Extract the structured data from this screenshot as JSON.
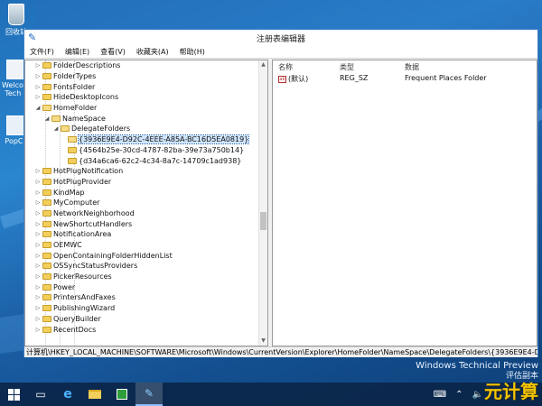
{
  "desktop": {
    "icons": [
      {
        "label": "回收站"
      },
      {
        "label": "Welcome Tech P"
      },
      {
        "label": "PopCh"
      }
    ],
    "watermark_line1": "Windows Technical Preview",
    "watermark_line2": "评估副本",
    "logo_text": "元计算"
  },
  "window": {
    "title": "注册表编辑器",
    "menus": [
      "文件(F)",
      "编辑(E)",
      "查看(V)",
      "收藏夹(A)",
      "帮助(H)"
    ]
  },
  "tree": {
    "rows": [
      {
        "label": "FolderDescriptions",
        "arrow": "▷"
      },
      {
        "label": "FolderTypes",
        "arrow": "▷"
      },
      {
        "label": "FontsFolder",
        "arrow": "▷"
      },
      {
        "label": "HideDesktopIcons",
        "arrow": "▷"
      },
      {
        "label": "HomeFolder",
        "arrow": "◢"
      },
      {
        "label": "NameSpace",
        "arrow": "◢"
      },
      {
        "label": "DelegateFolders",
        "arrow": "◢"
      },
      {
        "label": "{3936E9E4-D92C-4EEE-A85A-BC16D5EA0819}",
        "arrow": "",
        "selected": true
      },
      {
        "label": "{4564b25e-30cd-4787-82ba-39e73a750b14}",
        "arrow": ""
      },
      {
        "label": "{d34a6ca6-62c2-4c34-8a7c-14709c1ad938}",
        "arrow": ""
      },
      {
        "label": "HotPlugNotification",
        "arrow": "▷"
      },
      {
        "label": "HotPlugProvider",
        "arrow": "▷"
      },
      {
        "label": "KindMap",
        "arrow": "▷"
      },
      {
        "label": "MyComputer",
        "arrow": "▷"
      },
      {
        "label": "NetworkNeighborhood",
        "arrow": "▷"
      },
      {
        "label": "NewShortcutHandlers",
        "arrow": "▷"
      },
      {
        "label": "NotificationArea",
        "arrow": "▷"
      },
      {
        "label": "OEMWC",
        "arrow": "▷"
      },
      {
        "label": "OpenContainingFolderHiddenList",
        "arrow": "▷"
      },
      {
        "label": "OSSyncStatusProviders",
        "arrow": "▷"
      },
      {
        "label": "PickerResources",
        "arrow": "▷"
      },
      {
        "label": "Power",
        "arrow": "▷"
      },
      {
        "label": "PrintersAndFaxes",
        "arrow": "▷"
      },
      {
        "label": "PublishingWizard",
        "arrow": "▷"
      },
      {
        "label": "QueryBuilder",
        "arrow": "▷"
      },
      {
        "label": "RecentDocs",
        "arrow": "▷"
      }
    ]
  },
  "list": {
    "headers": {
      "name": "名称",
      "type": "类型",
      "data": "数据"
    },
    "rows": [
      {
        "name": "(默认)",
        "type": "REG_SZ",
        "data": "Frequent Places Folder",
        "icon": "ab-string-icon"
      }
    ]
  },
  "statusbar": {
    "path": "计算机\\HKEY_LOCAL_MACHINE\\SOFTWARE\\Microsoft\\Windows\\CurrentVersion\\Explorer\\HomeFolder\\NameSpace\\DelegateFolders\\{3936E9E4-D92C-4EEE-A"
  },
  "taskbar": {
    "apps": [
      "start-icon",
      "task-view-icon",
      "ie-icon",
      "file-explorer-icon",
      "store-icon",
      "regedit-icon"
    ],
    "tray": {
      "keyboard": "⌨",
      "arrow": "⌃",
      "volume": "🔈"
    }
  },
  "colors": {
    "selection": "#cfe5fb",
    "window_border": "#3a7fc7",
    "taskbar": "#0a2346"
  }
}
